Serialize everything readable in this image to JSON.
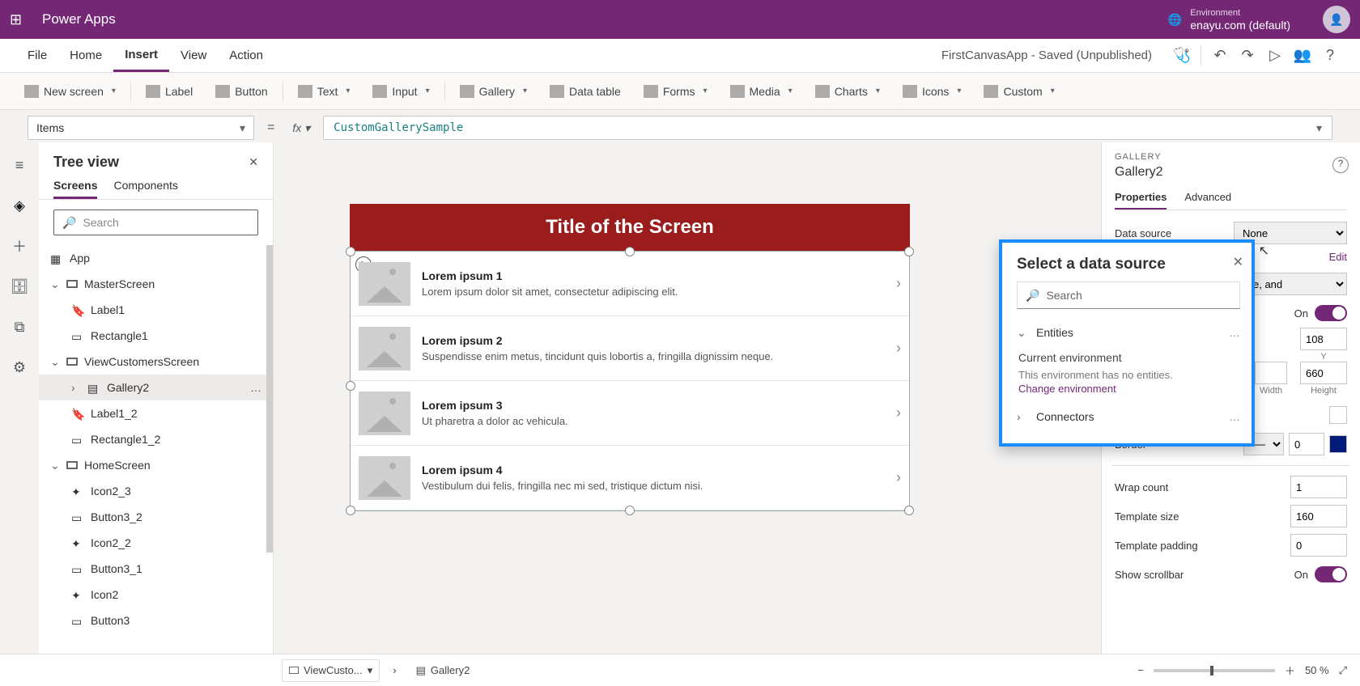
{
  "app_title": "Power Apps",
  "environment_label": "Environment",
  "environment_name": "enayu.com (default)",
  "menu": {
    "file": "File",
    "home": "Home",
    "insert": "Insert",
    "view": "View",
    "action": "Action",
    "document": "FirstCanvasApp - Saved (Unpublished)"
  },
  "ribbon": {
    "newscreen": "New screen",
    "label": "Label",
    "button": "Button",
    "text": "Text",
    "input": "Input",
    "gallery": "Gallery",
    "datatable": "Data table",
    "forms": "Forms",
    "media": "Media",
    "charts": "Charts",
    "icons": "Icons",
    "custom": "Custom"
  },
  "formula": {
    "prop": "Items",
    "value": "CustomGallerySample"
  },
  "tree": {
    "title": "Tree view",
    "tab_screens": "Screens",
    "tab_components": "Components",
    "search_ph": "Search",
    "app": "App",
    "master": "MasterScreen",
    "label1": "Label1",
    "rect1": "Rectangle1",
    "vcs": "ViewCustomersScreen",
    "gallery2": "Gallery2",
    "label1_2": "Label1_2",
    "rect1_2": "Rectangle1_2",
    "home": "HomeScreen",
    "i23": "Icon2_3",
    "b32": "Button3_2",
    "i22": "Icon2_2",
    "b31": "Button3_1",
    "i2": "Icon2",
    "b3": "Button3"
  },
  "canvas": {
    "screen_title": "Title of the Screen",
    "rows": [
      {
        "t": "Lorem ipsum 1",
        "s": "Lorem ipsum dolor sit amet, consectetur adipiscing elit."
      },
      {
        "t": "Lorem ipsum 2",
        "s": "Suspendisse enim metus, tincidunt quis lobortis a, fringilla dignissim neque."
      },
      {
        "t": "Lorem ipsum 3",
        "s": "Ut pharetra a dolor ac vehicula."
      },
      {
        "t": "Lorem ipsum 4",
        "s": "Vestibulum dui felis, fringilla nec mi sed, tristique dictum nisi."
      }
    ]
  },
  "props": {
    "ctype": "GALLERY",
    "cname": "Gallery2",
    "tab_props": "Properties",
    "tab_adv": "Advanced",
    "ds_label": "Data source",
    "ds_value": "None",
    "edit": "Edit",
    "layout_sub": "title, and",
    "visible_label": "On",
    "y": "108",
    "y_lbl": "Y",
    "h": "660",
    "h_lbl": "Height",
    "width_lbl": "Width",
    "bd_label": "Border",
    "bd_width": "0",
    "wrap_label": "Wrap count",
    "wrap_val": "1",
    "tpl_label": "Template size",
    "tpl_val": "160",
    "pad_label": "Template padding",
    "pad_val": "0",
    "scroll_label": "Show scrollbar",
    "scroll_val": "On"
  },
  "dspopup": {
    "title": "Select a data source",
    "search_ph": "Search",
    "entities": "Entities",
    "env": "Current environment",
    "msg": "This environment has no entities.",
    "change": "Change environment",
    "connectors": "Connectors"
  },
  "status": {
    "screen": "ViewCusto...",
    "sel": "Gallery2",
    "zoom": "50  %"
  }
}
